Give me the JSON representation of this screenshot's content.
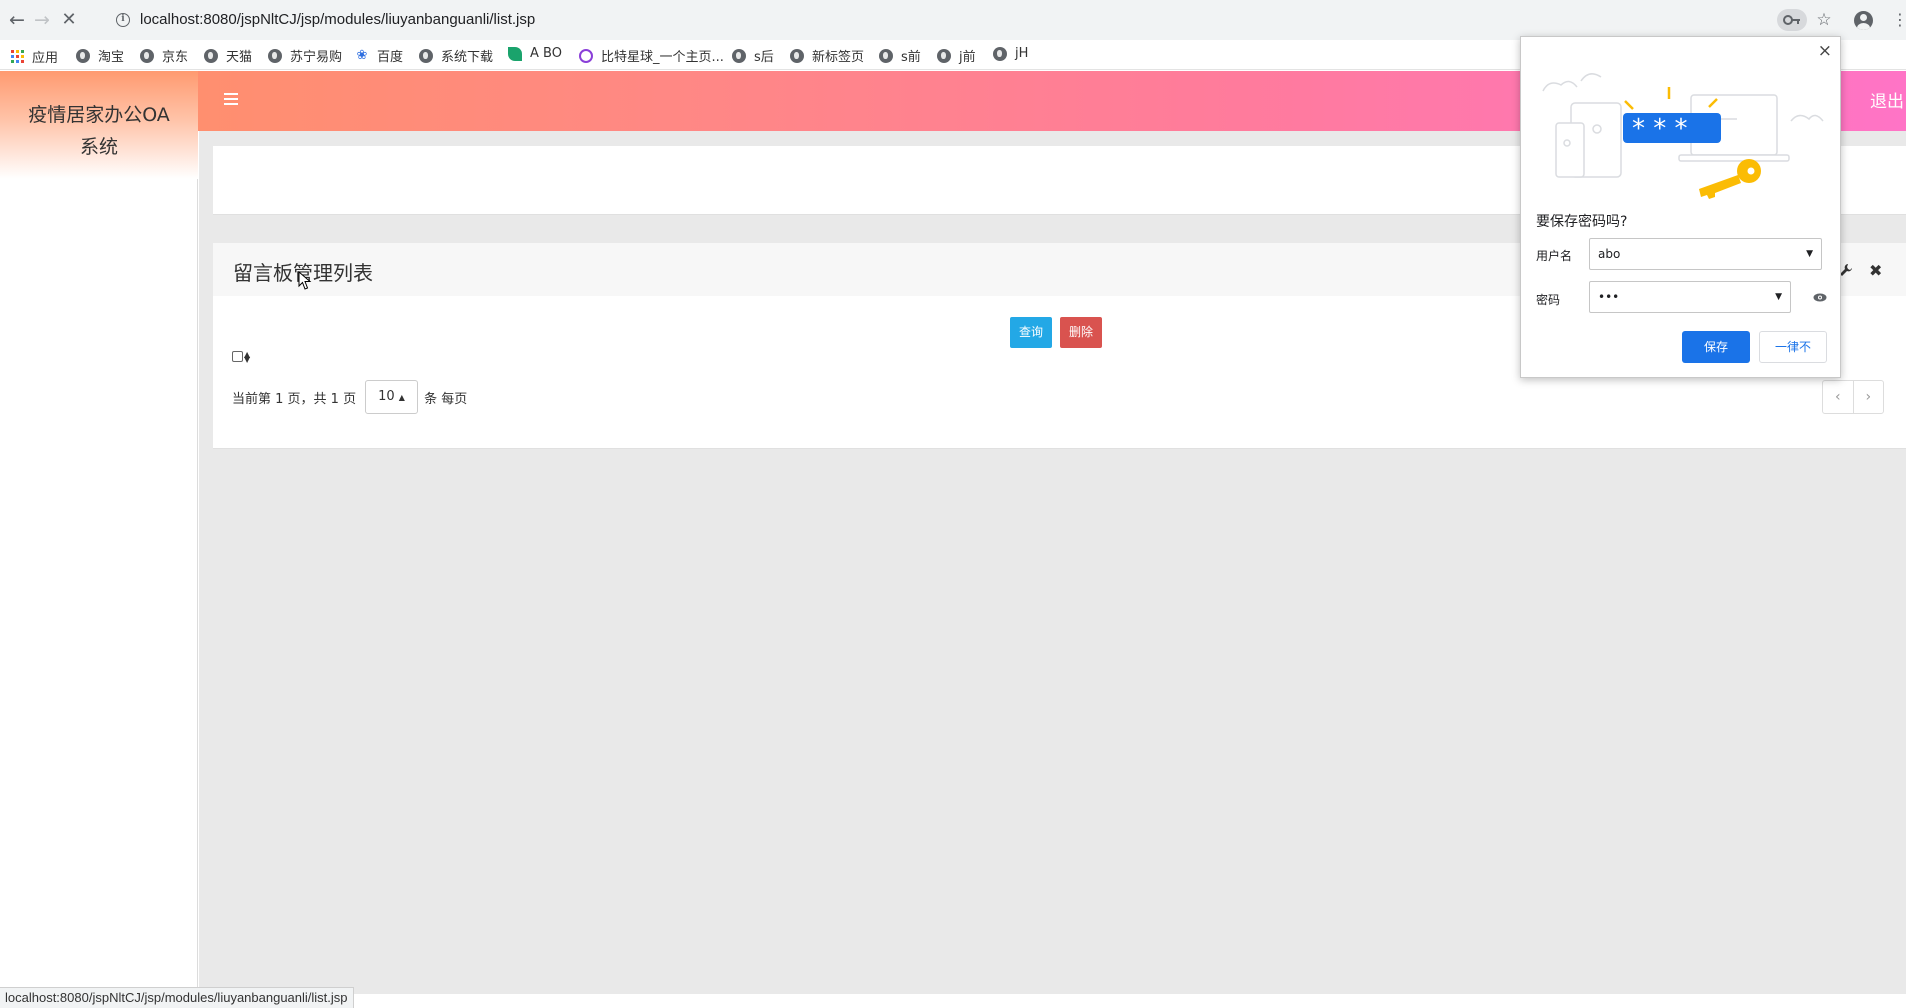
{
  "browser": {
    "url": "localhost:8080/jspNltCJ/jsp/modules/liuyanbanguanli/list.jsp",
    "status_url": "localhost:8080/jspNltCJ/jsp/modules/liuyanbanguanli/list.jsp",
    "bookmarks": [
      "应用",
      "淘宝",
      "京东",
      "天猫",
      "苏宁易购",
      "百度",
      "系统下载",
      "A BO",
      "比特星球_一个主页...",
      "s后",
      "新标签页",
      "s前",
      "j前",
      "jH"
    ]
  },
  "header": {
    "brand_line1": "疫情居家办公OA",
    "brand_line2": "系统",
    "logout_label": "退出"
  },
  "panel": {
    "title": "留言板管理列表",
    "query_label": "查询",
    "delete_label": "删除",
    "pager_prefix": "当前第 1 页，共 1 页",
    "page_size": "10",
    "pager_suffix": "条 每页",
    "prev_label": "‹",
    "next_label": "›"
  },
  "password_dialog": {
    "title": "要保存密码吗?",
    "username_label": "用户名",
    "username_value": "abo",
    "password_label": "密码",
    "password_value": "•••",
    "save_label": "保存",
    "never_label": "一律不",
    "close_label": "×"
  },
  "colors": {
    "header_start": "#ff9266",
    "header_end": "#ff74c6",
    "query_button": "#23a8e6",
    "delete_button": "#d9534f",
    "save_button": "#1a73e8"
  }
}
